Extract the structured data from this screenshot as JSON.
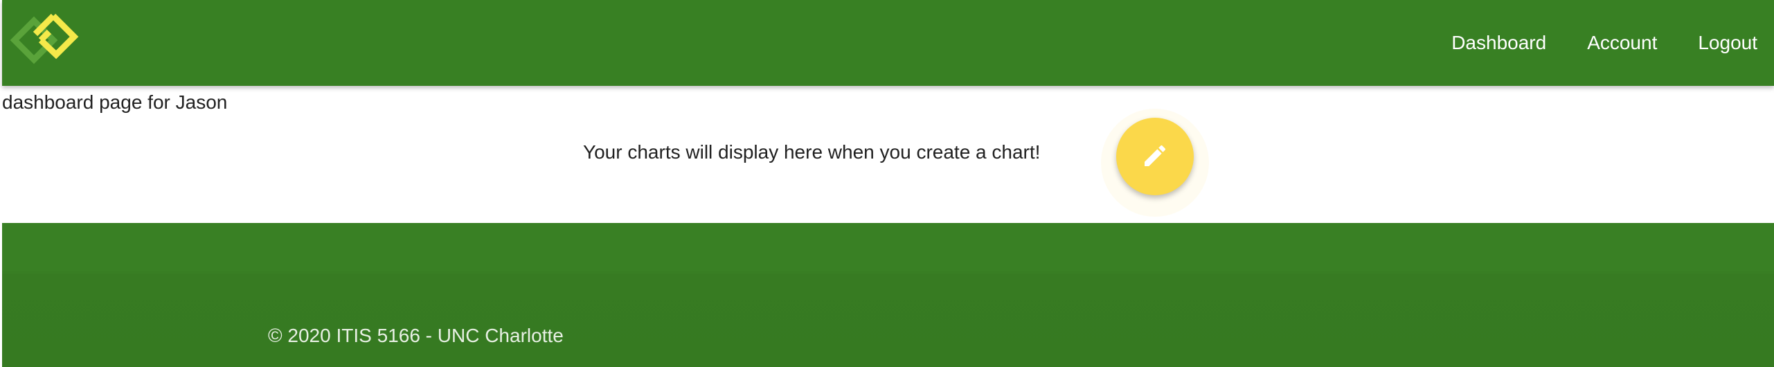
{
  "nav": {
    "logo_icon": "diamond-logo-icon",
    "links": [
      {
        "label": "Dashboard"
      },
      {
        "label": "Account"
      },
      {
        "label": "Logout"
      }
    ]
  },
  "main": {
    "page_heading": "dashboard page for Jason",
    "empty_message": "Your charts will display here when you create a chart!",
    "fab_icon": "pencil-icon"
  },
  "footer": {
    "copyright": "© 2020 ITIS 5166 - UNC Charlotte"
  },
  "colors": {
    "primary_green": "#388023",
    "accent_yellow": "#fbd84a",
    "logo_dark": "#4f9a2e",
    "logo_light": "#f3e94c"
  }
}
